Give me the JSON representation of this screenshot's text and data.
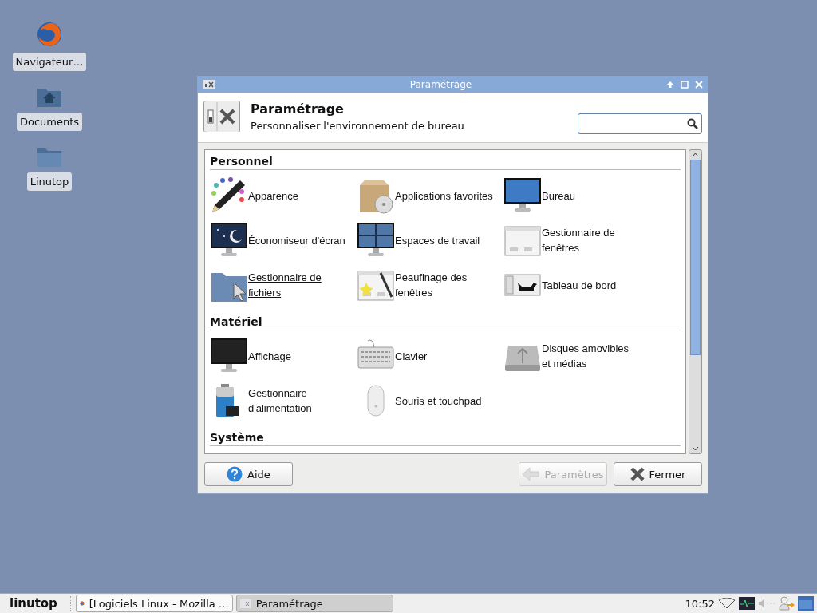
{
  "desktop_icons": [
    {
      "label": "Navigateur…",
      "kind": "browser"
    },
    {
      "label": "Documents",
      "kind": "home-folder"
    },
    {
      "label": "Linutop",
      "kind": "folder"
    }
  ],
  "window": {
    "title": "Paramétrage",
    "heading": "Paramétrage",
    "subtitle": "Personnaliser l'environnement de bureau",
    "sections": [
      {
        "title": "Personnel",
        "items": [
          {
            "label": "Apparence",
            "hovered": false
          },
          {
            "label": "Applications favorites",
            "hovered": false
          },
          {
            "label": "Bureau",
            "hovered": false
          },
          {
            "label": "Économiseur d'écran",
            "hovered": false
          },
          {
            "label": "Espaces de travail",
            "hovered": false
          },
          {
            "label": "Gestionnaire de fenêtres",
            "hovered": false
          },
          {
            "label": "Gestionnaire de fichiers",
            "hovered": true
          },
          {
            "label": "Peaufinage des fenêtres",
            "hovered": false
          },
          {
            "label": "Tableau de bord",
            "hovered": false
          }
        ]
      },
      {
        "title": "Matériel",
        "items": [
          {
            "label": "Affichage",
            "hovered": false
          },
          {
            "label": "Clavier",
            "hovered": false
          },
          {
            "label": "Disques amovibles et médias",
            "hovered": false
          },
          {
            "label": "Gestionnaire d'alimentation",
            "hovered": false
          },
          {
            "label": "Souris et touchpad",
            "hovered": false
          }
        ]
      },
      {
        "title": "Système"
      }
    ],
    "buttons": [
      {
        "label": "Aide",
        "kind": "help",
        "disabled": false
      },
      {
        "label": "Paramètres",
        "kind": "back",
        "disabled": true
      },
      {
        "label": "Fermer",
        "kind": "close",
        "disabled": false
      }
    ]
  },
  "taskbar": {
    "logo": "linutop",
    "tasks": [
      {
        "label": "[Logiciels Linux - Mozilla …",
        "kind": "browser",
        "selected": false
      },
      {
        "label": "Paramétrage",
        "kind": "settings",
        "selected": true
      }
    ],
    "clock": "10:52"
  }
}
